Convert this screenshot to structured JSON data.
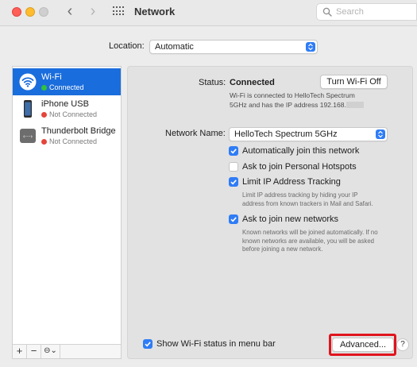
{
  "window": {
    "title": "Network",
    "search_placeholder": "Search"
  },
  "location": {
    "label": "Location:",
    "value": "Automatic"
  },
  "services": [
    {
      "name": "Wi-Fi",
      "status": "Connected",
      "status_color": "#30c23b",
      "selected": true,
      "icon": "wifi-icon"
    },
    {
      "name": "iPhone USB",
      "status": "Not Connected",
      "status_color": "#e5453a",
      "selected": false,
      "icon": "iphone-icon"
    },
    {
      "name": "Thunderbolt Bridge",
      "status": "Not Connected",
      "status_color": "#e5453a",
      "selected": false,
      "icon": "thunderbolt-bridge-icon"
    }
  ],
  "sidebar_controls": {
    "add": "+",
    "remove": "−",
    "gear": "⊖⌄"
  },
  "status": {
    "label": "Status:",
    "value": "Connected",
    "button": "Turn Wi-Fi Off",
    "description_line1": "Wi-Fi is connected to HelloTech Spectrum",
    "description_line2": "5GHz and has the IP address 192.168."
  },
  "network_name": {
    "label": "Network Name:",
    "value": "HelloTech Spectrum 5GHz"
  },
  "options": [
    {
      "label": "Automatically join this network",
      "checked": true
    },
    {
      "label": "Ask to join Personal Hotspots",
      "checked": false
    },
    {
      "label": "Limit IP Address Tracking",
      "checked": true,
      "desc_line1": "Limit IP address tracking by hiding your IP",
      "desc_line2": "address from known trackers in Mail and Safari."
    },
    {
      "label": "Ask to join new networks",
      "checked": true,
      "desc_line1": "Known networks will be joined automatically. If no",
      "desc_line2": "known networks are available, you will be asked",
      "desc_line3": "before joining a new network."
    }
  ],
  "show_status": {
    "label": "Show Wi-Fi status in menu bar",
    "checked": true
  },
  "advanced_button": "Advanced...",
  "help_button": "?",
  "colors": {
    "accent": "#2f7cf6",
    "selection": "#1a6ddc",
    "annotation": "#e0141d"
  }
}
